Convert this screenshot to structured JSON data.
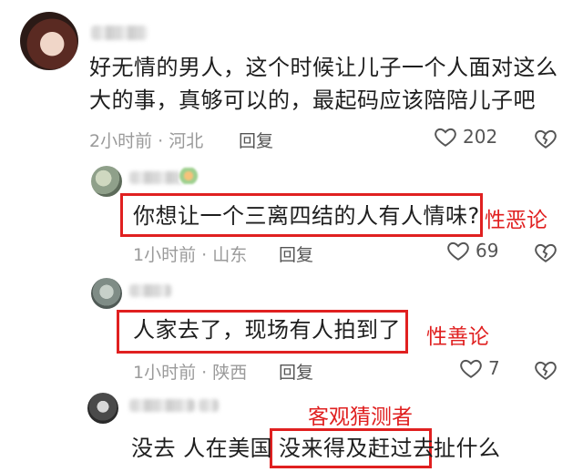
{
  "comments": [
    {
      "lines": [
        "好无情的男人，这个时候让儿子一个人面对这么",
        "大的事，真够可以的，最起码应该陪陪儿子吧"
      ],
      "meta": "2小时前 · 河北",
      "reply": "回复",
      "likes": "202"
    },
    {
      "text": "你想让一个三离四结的人有人情味?",
      "meta": "1小时前 · 山东",
      "reply": "回复",
      "likes": "69",
      "annotation": "性恶论"
    },
    {
      "text": "人家去了，现场有人拍到了",
      "meta": "1小时前 · 陕西",
      "reply": "回复",
      "likes": "7",
      "annotation": "性善论"
    },
    {
      "text_before": "没去 人在美国",
      "text_highlight": "没来得及赶过去",
      "text_after": "扯什么",
      "annotation": "客观猜测者"
    }
  ],
  "icons": {
    "like": "heart-icon",
    "dislike": "broken-heart-icon"
  },
  "colors": {
    "annotation_red": "#e02020",
    "meta_gray": "#9a9a9a"
  }
}
